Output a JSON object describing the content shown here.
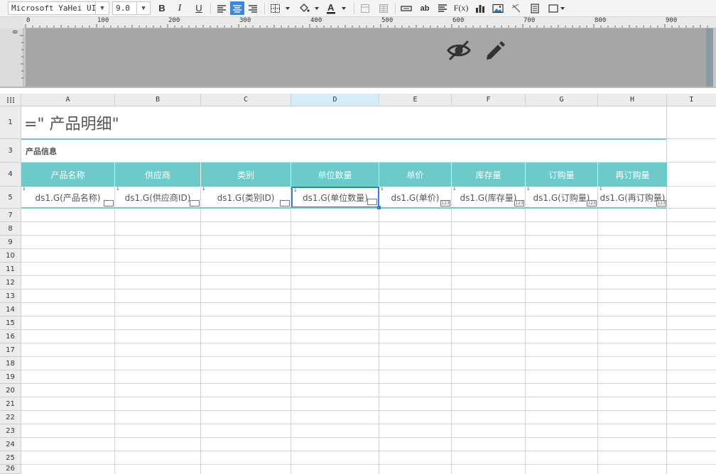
{
  "toolbar": {
    "font_name": "Microsoft YaHei UI",
    "font_size": "9.0",
    "bold": "B",
    "italic": "I",
    "underline": "U",
    "text_ab": "ab",
    "fx": "F(x)"
  },
  "ruler": {
    "labels": [
      "0",
      "100",
      "200",
      "300",
      "400",
      "500",
      "600",
      "700",
      "800",
      "900"
    ],
    "vertical_label": "0"
  },
  "sheet": {
    "columns": [
      "A",
      "B",
      "C",
      "D",
      "E",
      "F",
      "G",
      "H",
      "I"
    ],
    "selected_column": "D",
    "rows": [
      "1",
      "3",
      "4",
      "5",
      "7",
      "8",
      "9",
      "10",
      "11",
      "12",
      "13",
      "14",
      "15",
      "16",
      "17",
      "18",
      "19",
      "20",
      "21",
      "22",
      "23",
      "24",
      "25",
      "26"
    ],
    "title_formula": "=\" 产品明细\"",
    "section_label": "产品信息",
    "headers": [
      "产品名称",
      "供应商",
      "类别",
      "单位数量",
      "单价",
      "库存量",
      "订购量",
      "再订购量"
    ],
    "data_cells": [
      "ds1.G(产品名称)",
      "ds1.G(供应商ID)",
      "ds1.G(类别ID)",
      "ds1.G(单位数量)",
      "ds1.G(单价)",
      "ds1.G(库存量)",
      "ds1.G(订购量)",
      "ds1.G(再订购量)"
    ],
    "numeric_badge": "123"
  },
  "colors": {
    "header_fill": "#6ccac9",
    "selection_border": "#2f7fe0",
    "accent_line": "#6ccac9"
  }
}
